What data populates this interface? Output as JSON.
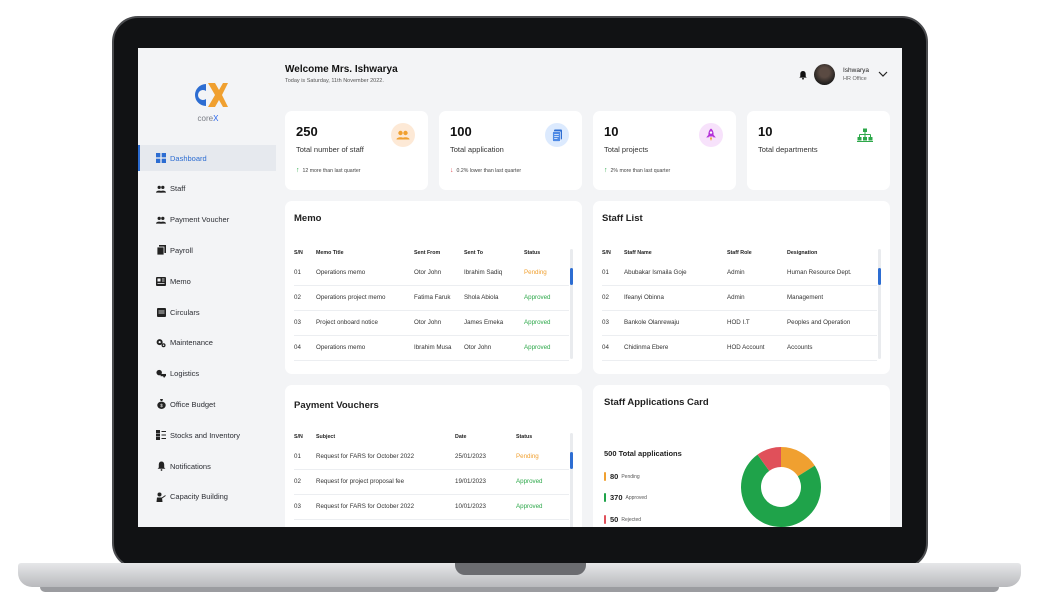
{
  "brand": {
    "name_prefix": "core",
    "name_suffix": "X"
  },
  "header": {
    "welcome": "Welcome Mrs. Ishwarya",
    "date": "Today is Saturday, 11th November 2022.",
    "user_name": "Ishwarya",
    "user_role": "HR Office"
  },
  "sidebar": {
    "items": [
      {
        "label": "Dashboard",
        "icon": "grid-icon"
      },
      {
        "label": "Staff",
        "icon": "users-icon"
      },
      {
        "label": "Payment Voucher",
        "icon": "users-icon"
      },
      {
        "label": "Payroll",
        "icon": "document-icon"
      },
      {
        "label": "Memo",
        "icon": "newspaper-icon"
      },
      {
        "label": "Circulars",
        "icon": "note-icon"
      },
      {
        "label": "Maintenance",
        "icon": "gears-icon"
      },
      {
        "label": "Logistics",
        "icon": "truck-icon"
      },
      {
        "label": "Office Budget",
        "icon": "money-bag-icon"
      },
      {
        "label": "Stocks and Inventory",
        "icon": "inventory-icon"
      },
      {
        "label": "Notifications",
        "icon": "bell-icon"
      },
      {
        "label": "Capacity Building",
        "icon": "training-icon"
      }
    ],
    "active_index": 0
  },
  "stats": [
    {
      "value": "250",
      "label": "Total number of staff",
      "trend": "12 more than last quarter",
      "trend_dir": "up",
      "icon": "users-icon",
      "icon_bg": "#fde9d6",
      "icon_color": "#f0a030"
    },
    {
      "value": "100",
      "label": "Total application",
      "trend": "0.2% lower than last quarter",
      "trend_dir": "down",
      "icon": "document-icon",
      "icon_bg": "#dceafe",
      "icon_color": "#2d6dd2"
    },
    {
      "value": "10",
      "label": "Total projects",
      "trend": "2% more than last quarter",
      "trend_dir": "up",
      "icon": "rocket-icon",
      "icon_bg": "#f7e2fb",
      "icon_color": "#b430d8"
    },
    {
      "value": "10",
      "label": "Total departments",
      "trend": "",
      "trend_dir": "",
      "icon": "org-chart-icon",
      "icon_bg": "#def6e3",
      "icon_color": "#2da84a"
    }
  ],
  "memo": {
    "title": "Memo",
    "columns": [
      "S/N",
      "Memo Title",
      "Sent From",
      "Sent To",
      "Status"
    ],
    "rows": [
      [
        "01",
        "Operations memo",
        "Otor John",
        "Ibrahim Sadiq",
        "Pending"
      ],
      [
        "02",
        "Operations project memo",
        "Fatima Faruk",
        "Shola Abiola",
        "Approved"
      ],
      [
        "03",
        "Project onboard notice",
        "Otor John",
        "James Emeka",
        "Approved"
      ],
      [
        "04",
        "Operations memo",
        "Ibrahim Musa",
        "Otor John",
        "Approved"
      ]
    ]
  },
  "staff_list": {
    "title": "Staff List",
    "columns": [
      "S/N",
      "Staff Name",
      "Staff Role",
      "Designation"
    ],
    "rows": [
      [
        "01",
        "Abubakar Ismaila Goje",
        "Admin",
        "Human Resource Dept."
      ],
      [
        "02",
        "Ifeanyi Obinna",
        "Admin",
        "Management"
      ],
      [
        "03",
        "Bankole Olanrewaju",
        "HOD I.T",
        "Peoples and Operation"
      ],
      [
        "04",
        "Chidinma Ebere",
        "HOD Account",
        "Accounts"
      ]
    ]
  },
  "payment_vouchers": {
    "title": "Payment Vouchers",
    "columns": [
      "S/N",
      "Subject",
      "Date",
      "Status"
    ],
    "rows": [
      [
        "01",
        "Request for FARS for October 2022",
        "25/01/2023",
        "Pending"
      ],
      [
        "02",
        "Request for project proposal fee",
        "19/01/2023",
        "Approved"
      ],
      [
        "03",
        "Request for FARS for October 2022",
        "10/01/2023",
        "Approved"
      ]
    ]
  },
  "applications": {
    "title": "Staff Applications Card",
    "total_label": "500 Total applications",
    "legend": [
      {
        "value": "80",
        "label": "Pending",
        "color": "#f0a030"
      },
      {
        "value": "370",
        "label": "Approved",
        "color": "#1fa34a"
      },
      {
        "value": "50",
        "label": "Rejected",
        "color": "#e0505a"
      }
    ]
  },
  "colors": {
    "accent": "#2d6dd2",
    "pending": "#f0a030",
    "approved": "#2da84a"
  }
}
